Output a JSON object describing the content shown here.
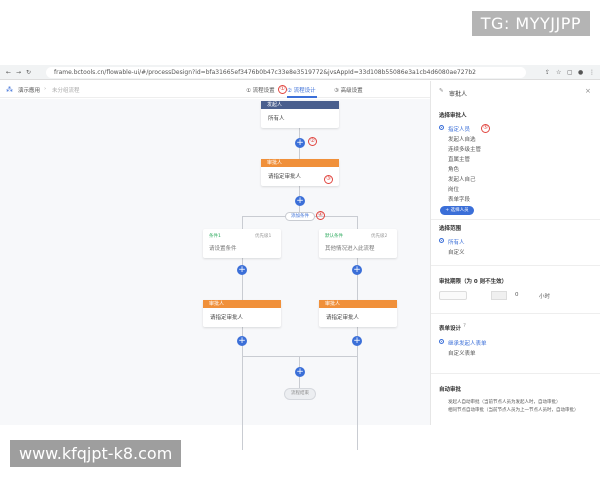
{
  "watermark_top": "TG: MYYJJPP",
  "watermark_bottom": "www.kfqjpt-k8.com",
  "browser": {
    "url": "frame.bctools.cn/flowable-ui/#/processDesign?id=bfa31665ef3476b0b47c33e8e3519772&jvsAppId=33d108b55086e3a1cb4d6080ae727b2"
  },
  "app": {
    "title": "演示應用",
    "breadcrumb": "未分组流程",
    "tabs": [
      "① 流程设置",
      "② 流程设计",
      "③ 高级设置"
    ]
  },
  "flow": {
    "start_header": "发起人",
    "start_body": "所有人",
    "approver_header": "审批人",
    "approver_body": "请指定审批人",
    "condition_label": "添加条件",
    "cond_left_title": "条件1",
    "cond_left_priority": "优先级1",
    "cond_left_body": "请设置条件",
    "cond_right_title": "默认条件",
    "cond_right_priority": "优先级2",
    "cond_right_body": "其他情况进入此流程",
    "branch_left_header": "审批人",
    "branch_left_body": "请指定审批人",
    "branch_right_header": "审批人",
    "branch_right_body": "请指定审批人",
    "end": "流程结束",
    "markers": [
      "①",
      "②",
      "③",
      "④",
      "⑤"
    ]
  },
  "panel": {
    "title": "审批人",
    "section_select": "选择审批人",
    "options": [
      "指定人员",
      "发起人自选",
      "连续多级主管",
      "直属主管",
      "角色",
      "发起人自己",
      "岗位",
      "表单字段"
    ],
    "selected_option": "指定人员",
    "select_button": "+ 选择人员",
    "section_range": "选择范围",
    "range_options": [
      "所有人",
      "自定义"
    ],
    "section_deadline": "审批期限（为 0 则不生效）",
    "deadline_fields": [
      "0",
      "小时"
    ],
    "section_form": "表单设计",
    "form_options": [
      "继承发起人表单",
      "自定义表单"
    ],
    "section_auto": "自动审批",
    "auto_lines": [
      "发起人自动审批（当前节点人员为发起人时，自动审批）",
      "相同节点自动审批（当前节点人员为上一节点人员时，自动审批）"
    ]
  },
  "colors": {
    "accent": "#3b6fd8",
    "start": "#4a5f8e",
    "approver": "#f0903a",
    "marker": "#e0443e"
  }
}
